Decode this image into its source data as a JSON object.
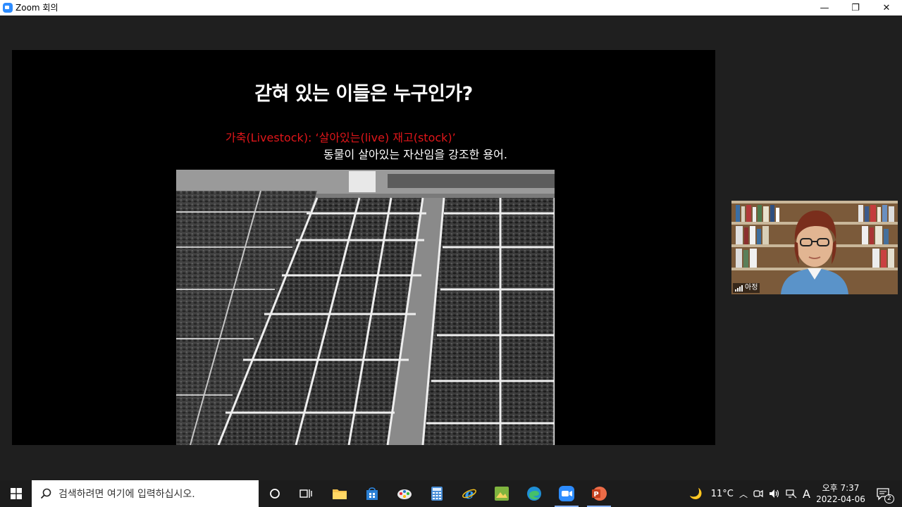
{
  "window": {
    "title": "Zoom 회의",
    "controls": {
      "minimize": "—",
      "restore": "❐",
      "close": "✕"
    }
  },
  "slide": {
    "title": "갇혀 있는 이들은 누구인가?",
    "line1": "가축(Livestock): ‘살아있는(live) 재고(stock)’",
    "line2": "동물이 살아있는 자산임을 강조한 용어.",
    "line1_color": "#e0161a",
    "photo_icon": "stockyard-aerial-photo"
  },
  "participant": {
    "name": "아정"
  },
  "taskbar": {
    "search_placeholder": "검색하려면 여기에 입력하십시오.",
    "apps": [
      "task-view",
      "file-explorer",
      "store",
      "paint",
      "calculator",
      "internet-explorer",
      "photos",
      "edge",
      "zoom",
      "powerpoint"
    ],
    "weather": {
      "temp": "11°C",
      "icon": "moon-icon"
    },
    "ime": "A",
    "clock": {
      "time": "오후 7:37",
      "date": "2022-04-06"
    },
    "notifications": "2"
  },
  "colors": {
    "zoom_blue": "#2d8cff",
    "taskbar": "#1c1c1c",
    "meeting_bg": "#1f1f1f"
  }
}
